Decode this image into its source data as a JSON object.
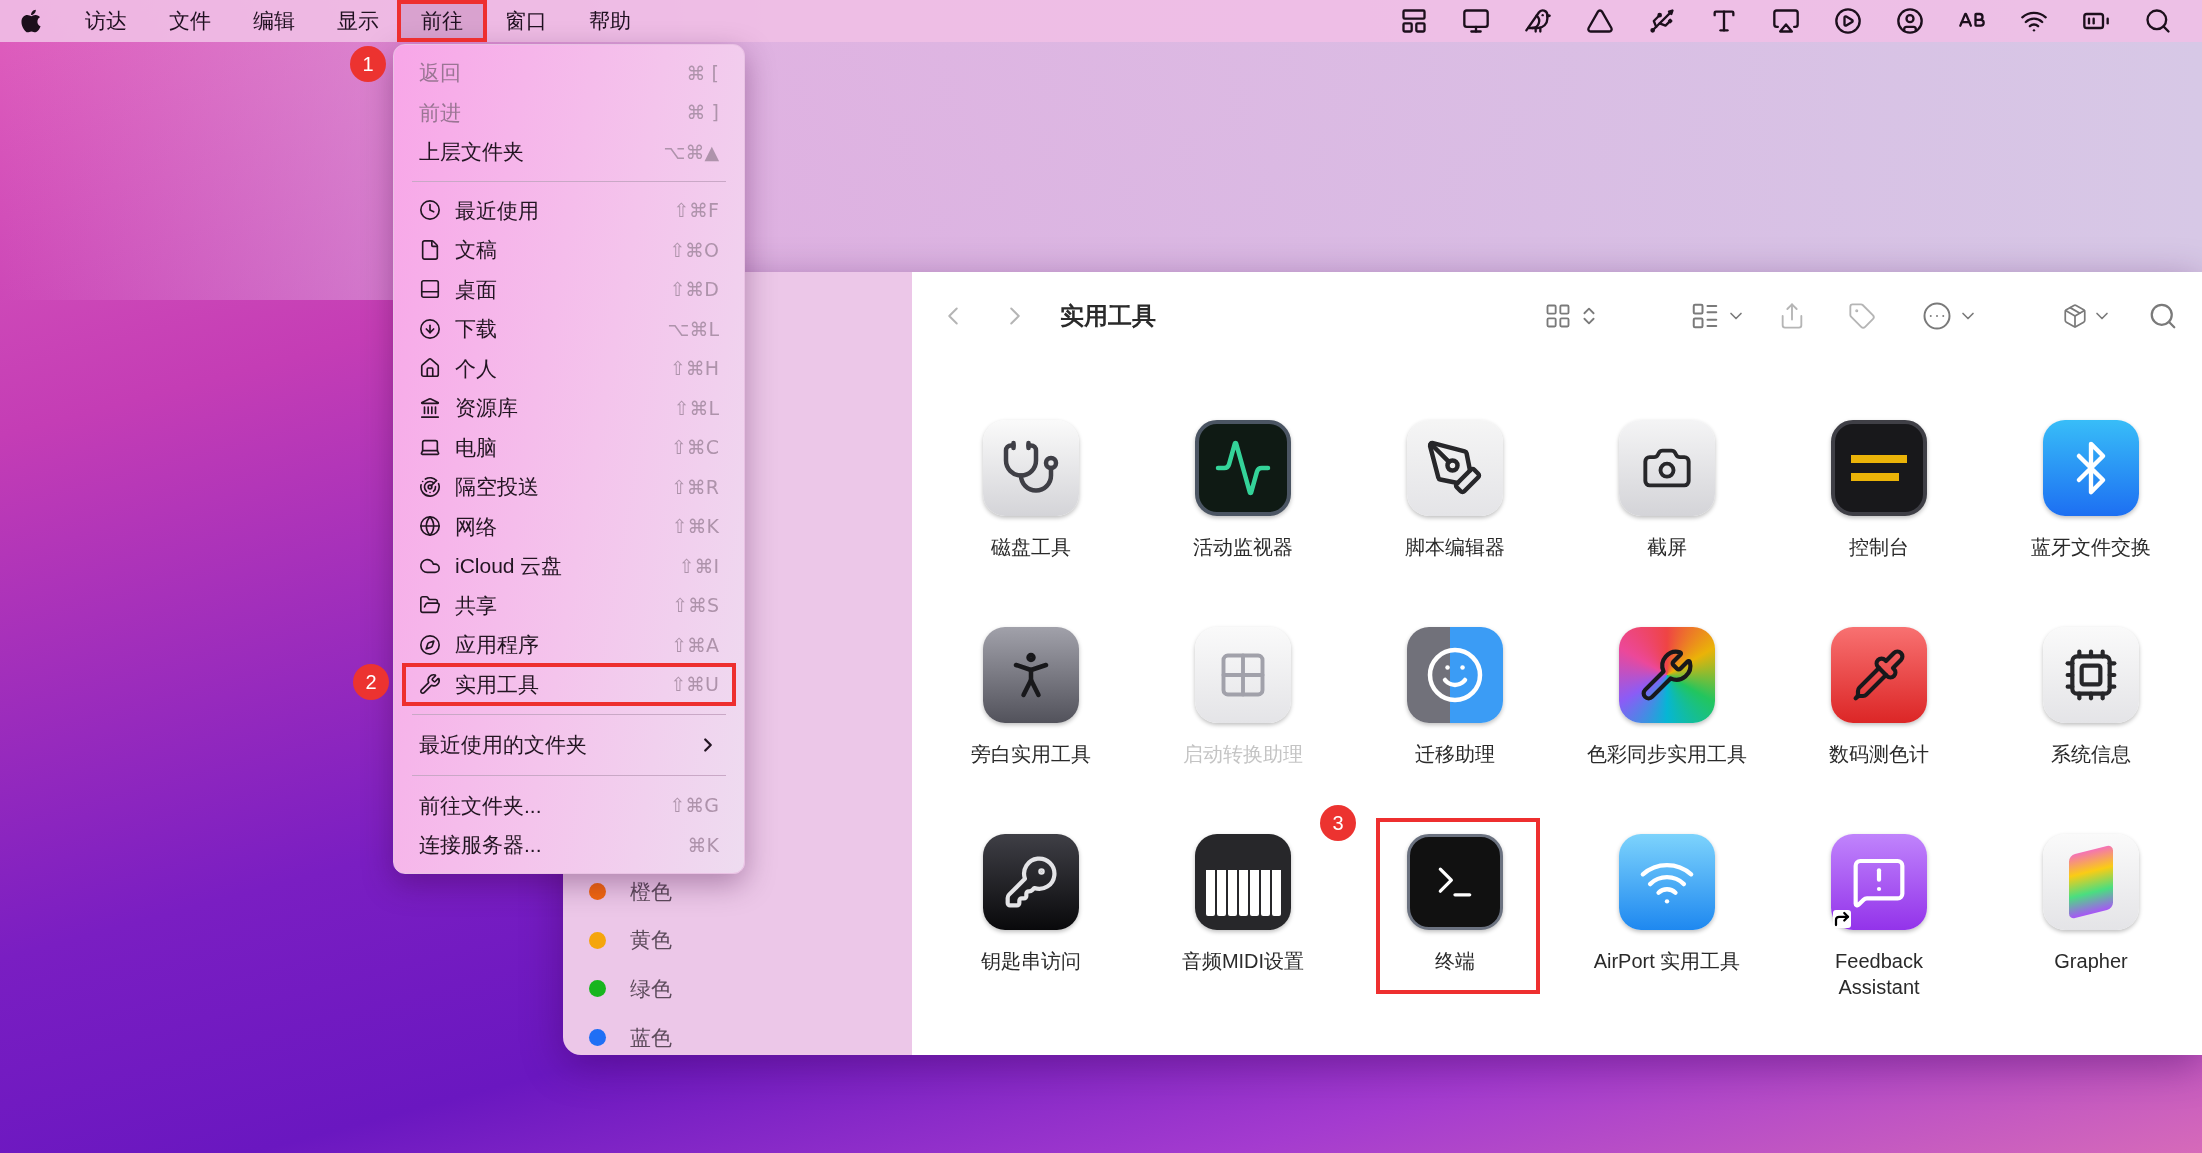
{
  "menu_bar": {
    "items": [
      {
        "label": "访达",
        "selected": false
      },
      {
        "label": "文件",
        "selected": false
      },
      {
        "label": "编辑",
        "selected": false
      },
      {
        "label": "显示",
        "selected": false
      },
      {
        "label": "前往",
        "selected": true
      },
      {
        "label": "窗口",
        "selected": false
      },
      {
        "label": "帮助",
        "selected": false
      }
    ]
  },
  "go_menu": {
    "sections": [
      {
        "items": [
          {
            "kind": "plain",
            "label": "返回",
            "shortcut": "⌘ [",
            "disabled": true,
            "marked": false
          },
          {
            "kind": "plain",
            "label": "前进",
            "shortcut": "⌘ ]",
            "disabled": true,
            "marked": false
          },
          {
            "kind": "plain",
            "label": "上层文件夹",
            "shortcut": "⌥⌘▲",
            "disabled": false,
            "marked": false
          }
        ]
      },
      {
        "items": [
          {
            "kind": "place",
            "label": "最近使用",
            "shortcut": "⇧⌘F",
            "disabled": false,
            "marked": false
          },
          {
            "kind": "place",
            "label": "文稿",
            "shortcut": "⇧⌘O",
            "disabled": false,
            "marked": false
          },
          {
            "kind": "place",
            "label": "桌面",
            "shortcut": "⇧⌘D",
            "disabled": false,
            "marked": false
          },
          {
            "kind": "place",
            "label": "下载",
            "shortcut": "⌥⌘L",
            "disabled": false,
            "marked": false
          },
          {
            "kind": "place",
            "label": "个人",
            "shortcut": "⇧⌘H",
            "disabled": false,
            "marked": false
          },
          {
            "kind": "place",
            "label": "资源库",
            "shortcut": "⇧⌘L",
            "disabled": false,
            "marked": false
          },
          {
            "kind": "place",
            "label": "电脑",
            "shortcut": "⇧⌘C",
            "disabled": false,
            "marked": false
          },
          {
            "kind": "place",
            "label": "隔空投送",
            "shortcut": "⇧⌘R",
            "disabled": false,
            "marked": false
          },
          {
            "kind": "place",
            "label": "网络",
            "shortcut": "⇧⌘K",
            "disabled": false,
            "marked": false
          },
          {
            "kind": "place",
            "label": "iCloud 云盘",
            "shortcut": "⇧⌘I",
            "disabled": false,
            "marked": false
          },
          {
            "kind": "place",
            "label": "共享",
            "shortcut": "⇧⌘S",
            "disabled": false,
            "marked": false
          },
          {
            "kind": "place",
            "label": "应用程序",
            "shortcut": "⇧⌘A",
            "disabled": false,
            "marked": false
          },
          {
            "kind": "place",
            "label": "实用工具",
            "shortcut": "⇧⌘U",
            "disabled": false,
            "marked": true
          }
        ]
      },
      {
        "items": [
          {
            "kind": "submenu",
            "label": "最近使用的文件夹",
            "disabled": false,
            "marked": false
          }
        ]
      },
      {
        "items": [
          {
            "kind": "plain",
            "label": "前往文件夹...",
            "shortcut": "⇧⌘G",
            "disabled": false,
            "marked": false
          },
          {
            "kind": "plain",
            "label": "连接服务器...",
            "shortcut": "⌘K",
            "disabled": false,
            "marked": false
          }
        ]
      }
    ]
  },
  "finder": {
    "title": "实用工具",
    "sidebar_tags": [
      {
        "label": "橙色",
        "color": "#f2680f"
      },
      {
        "label": "黄色",
        "color": "#f5a50c"
      },
      {
        "label": "绿色",
        "color": "#18b51e"
      },
      {
        "label": "蓝色",
        "color": "#1f6ff5"
      }
    ],
    "apps": [
      {
        "label": "磁盘工具",
        "disabled": false
      },
      {
        "label": "活动监视器",
        "disabled": false
      },
      {
        "label": "脚本编辑器",
        "disabled": false
      },
      {
        "label": "截屏",
        "disabled": false
      },
      {
        "label": "控制台",
        "disabled": false
      },
      {
        "label": "蓝牙文件交换",
        "disabled": false
      },
      {
        "label": "旁白实用工具",
        "disabled": false
      },
      {
        "label": "启动转换助理",
        "disabled": true
      },
      {
        "label": "迁移助理",
        "disabled": false
      },
      {
        "label": "色彩同步实用工具",
        "disabled": false
      },
      {
        "label": "数码测色计",
        "disabled": false
      },
      {
        "label": "系统信息",
        "disabled": false
      },
      {
        "label": "钥匙串访问",
        "disabled": false
      },
      {
        "label": "音频MIDI设置",
        "disabled": false
      },
      {
        "label": "终端",
        "disabled": false
      },
      {
        "label": "AirPort 实用工具",
        "disabled": false
      },
      {
        "label": "Feedback\nAssistant",
        "disabled": false
      },
      {
        "label": "Grapher",
        "disabled": false
      }
    ]
  },
  "annotations": [
    {
      "number": "1"
    },
    {
      "number": "2"
    },
    {
      "number": "3"
    }
  ]
}
